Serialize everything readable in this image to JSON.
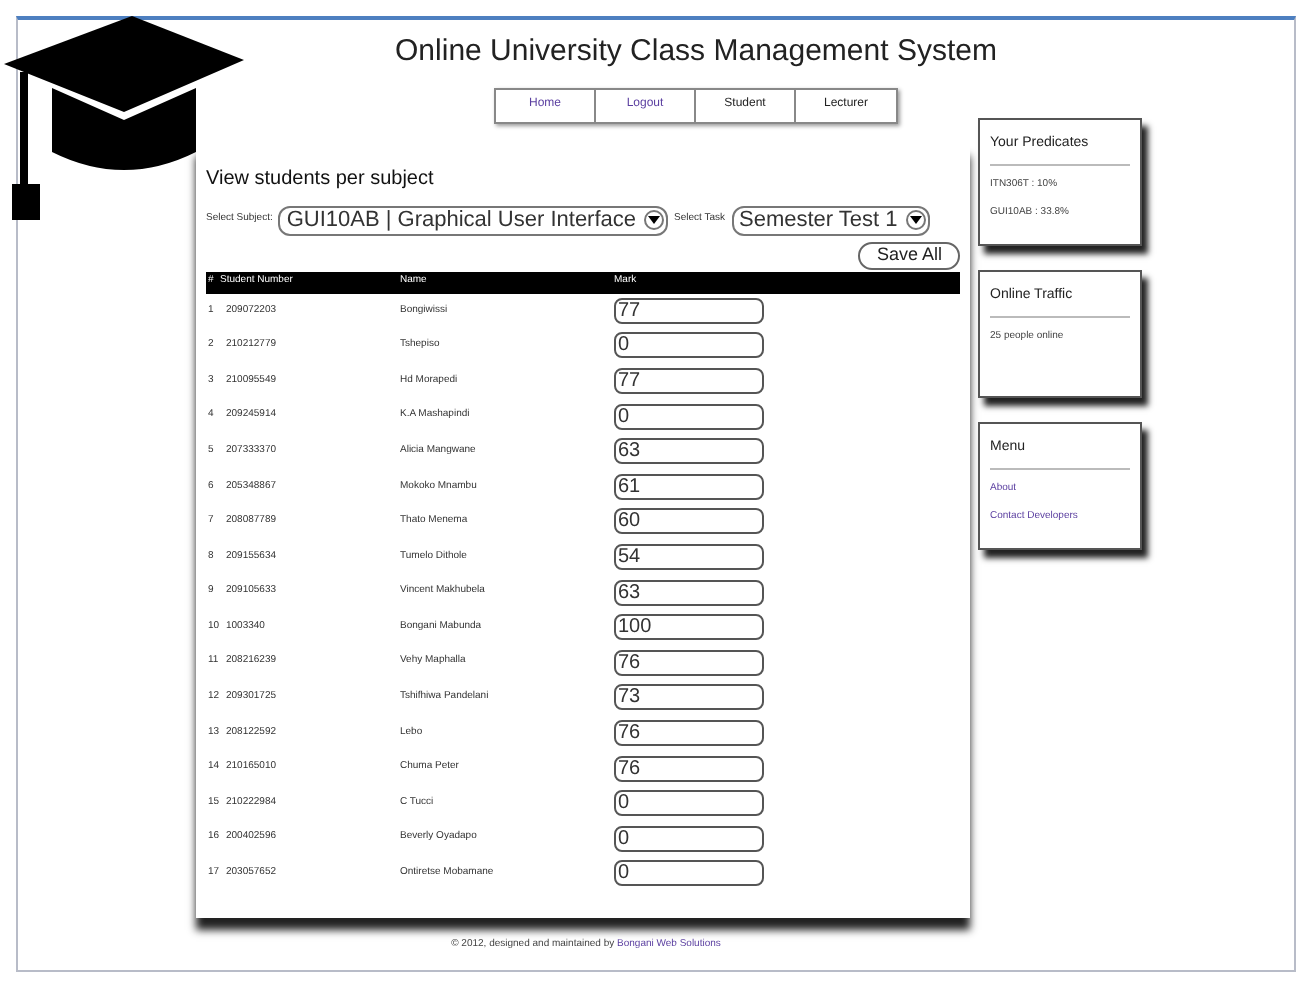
{
  "site_title": "Online University Class Management System",
  "nav": [
    {
      "label": "Home",
      "color": "#5b3fa0"
    },
    {
      "label": "Logout",
      "color": "#5b3fa0"
    },
    {
      "label": "Student",
      "color": "#222222"
    },
    {
      "label": "Lecturer",
      "color": "#222222"
    }
  ],
  "main": {
    "heading": "View students per subject",
    "subject_label": "Select Subject:",
    "subject_value": "GUI10AB | Graphical User Interface",
    "task_label": "Select Task",
    "task_value": "Semester Test 1",
    "save_button": "Save All",
    "columns": [
      "#",
      "Student Number",
      "Name",
      "Mark"
    ],
    "rows": [
      {
        "index": "1",
        "student_number": "209072203",
        "name": "Bongiwissi",
        "mark": "77"
      },
      {
        "index": "2",
        "student_number": "210212779",
        "name": "Tshepiso",
        "mark": "0"
      },
      {
        "index": "3",
        "student_number": "210095549",
        "name": "Hd Morapedi",
        "mark": "77"
      },
      {
        "index": "4",
        "student_number": "209245914",
        "name": "K.A Mashapindi",
        "mark": "0"
      },
      {
        "index": "5",
        "student_number": "207333370",
        "name": "Alicia Mangwane",
        "mark": "63"
      },
      {
        "index": "6",
        "student_number": "205348867",
        "name": "Mokoko Mnambu",
        "mark": "61"
      },
      {
        "index": "7",
        "student_number": "208087789",
        "name": "Thato Menema",
        "mark": "60"
      },
      {
        "index": "8",
        "student_number": "209155634",
        "name": "Tumelo Dithole",
        "mark": "54"
      },
      {
        "index": "9",
        "student_number": "209105633",
        "name": "Vincent Makhubela",
        "mark": "63"
      },
      {
        "index": "10",
        "student_number": "1003340",
        "name": "Bongani Mabunda",
        "mark": "100"
      },
      {
        "index": "11",
        "student_number": "208216239",
        "name": "Vehy Maphalla",
        "mark": "76"
      },
      {
        "index": "12",
        "student_number": "209301725",
        "name": "Tshifhiwa Pandelani",
        "mark": "73"
      },
      {
        "index": "13",
        "student_number": "208122592",
        "name": "Lebo",
        "mark": "76"
      },
      {
        "index": "14",
        "student_number": "210165010",
        "name": "Chuma Peter",
        "mark": "76"
      },
      {
        "index": "15",
        "student_number": "210222984",
        "name": "C Tucci",
        "mark": "0"
      },
      {
        "index": "16",
        "student_number": "200402596",
        "name": "Beverly Oyadapo",
        "mark": "0"
      },
      {
        "index": "17",
        "student_number": "203057652",
        "name": "Ontiretse Mobamane",
        "mark": "0"
      }
    ]
  },
  "sidebar": [
    {
      "title": "Your Predicates",
      "kind": "text",
      "lines": [
        "ITN306T : 10%",
        "GUI10AB : 33.8%"
      ]
    },
    {
      "title": "Online Traffic",
      "kind": "text",
      "lines": [
        "25 people online"
      ]
    },
    {
      "title": "Menu",
      "kind": "links",
      "lines": [
        "About",
        "Contact Developers"
      ]
    }
  ],
  "footer": {
    "text": "© 2012, designed and maintained by",
    "link": "Bongani Web Solutions"
  }
}
